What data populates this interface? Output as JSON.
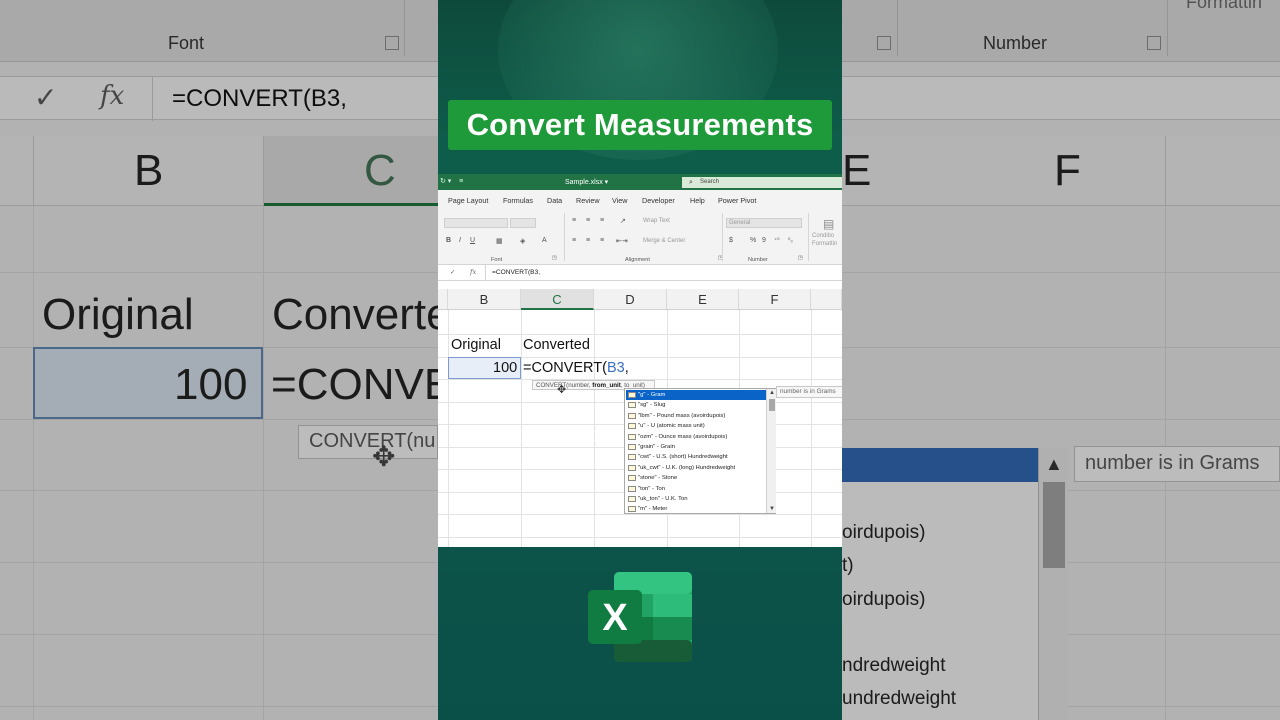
{
  "title": "Convert Measurements",
  "background": {
    "ribbon_groups": [
      "Font",
      "Number",
      "Formattin"
    ],
    "formula_bar_text": "=CONVERT(B3,",
    "column_headers": [
      "B",
      "C",
      "E",
      "F"
    ],
    "cell_original_label": "Original",
    "cell_converted_label": "Converte",
    "cell_value": "100",
    "cell_formula": "=CONVE",
    "tooltip": "CONVERT(nu",
    "hint": "number is in Grams",
    "list_items": [
      "oirdupois)",
      "t)",
      "oirdupois)",
      "ndredweight",
      "undredweight"
    ]
  },
  "excel": {
    "filename": "Sample.xlsx ▾",
    "search_placeholder": "Search",
    "tabs": [
      "Page Layout",
      "Formulas",
      "Data",
      "Review",
      "View",
      "Developer",
      "Help",
      "Power Pivot"
    ],
    "ribbon": {
      "wrap_text": "Wrap Text",
      "merge_center": "Merge & Center",
      "number_format": "General",
      "group_font": "Font",
      "group_alignment": "Alignment",
      "group_number": "Number",
      "conditional": "Conditio",
      "formatting": "Formattin"
    },
    "formula_bar": "=CONVERT(B3,",
    "columns": [
      "B",
      "C",
      "D",
      "E",
      "F"
    ],
    "cells": {
      "b2": "Original",
      "c2": "Converted",
      "b3": "100",
      "c3_prefix": "=CONVERT(",
      "c3_ref": "B3",
      "c3_suffix": ","
    },
    "tooltip": {
      "fn": "CONVERT(number, ",
      "arg": "from_unit",
      "rest": ", to_unit)"
    },
    "hint": "number is in Grams",
    "dropdown": [
      "\"g\" - Gram",
      "\"sg\" - Slug",
      "\"lbm\" - Pound mass (avoirdupois)",
      "\"u\" - U (atomic mass unit)",
      "\"ozm\" - Ounce mass (avoirdupois)",
      "\"grain\" - Grain",
      "\"cwt\" - U.S. (short) Hundredweight",
      "\"uk_cwt\" - U.K. (long) Hundredweight",
      "\"stone\" - Stone",
      "\"ton\" - Ton",
      "\"uk_ton\" - U.K. Ton",
      "\"m\" - Meter"
    ],
    "selected_index": 0
  },
  "colors": {
    "excel_green": "#217346",
    "badge_green": "#1f9a3a",
    "selection_blue": "#0a64c8"
  },
  "logo_letter": "X"
}
